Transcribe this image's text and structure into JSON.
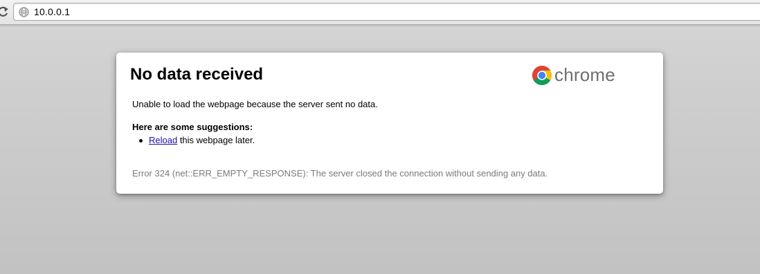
{
  "browser": {
    "url": "10.0.0.1"
  },
  "error_page": {
    "title": "No data received",
    "logo_text": "chrome",
    "summary": "Unable to load the webpage because the server sent no data.",
    "suggestions_heading": "Here are some suggestions:",
    "suggestion": {
      "link_text": "Reload",
      "rest_text": " this webpage later."
    },
    "error_code": "Error 324 (net::ERR_EMPTY_RESPONSE): The server closed the connection without sending any data."
  }
}
